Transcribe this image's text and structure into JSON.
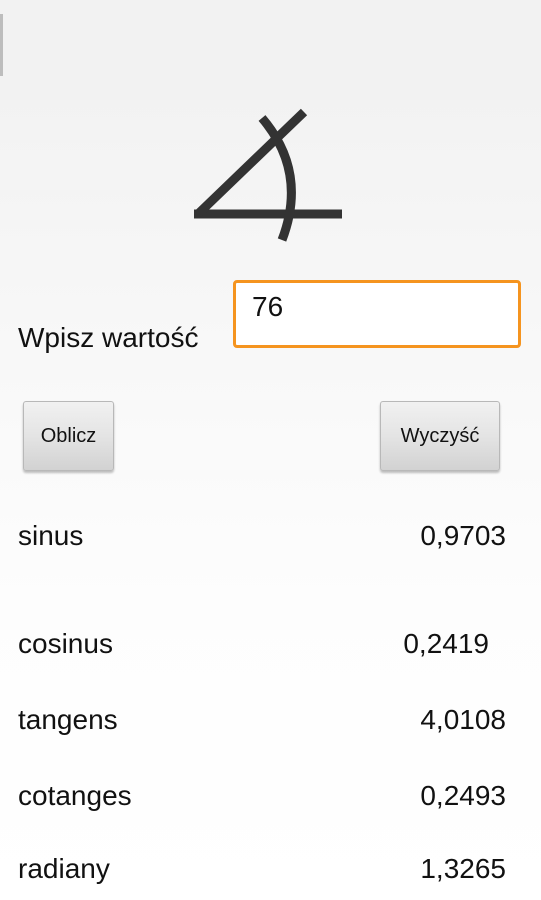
{
  "logo": {
    "icon": "angle-icon"
  },
  "form": {
    "label": "Wpisz wartość",
    "input_value": "76"
  },
  "buttons": {
    "calculate": "Oblicz",
    "clear": "Wyczyść"
  },
  "results": [
    {
      "label": "sinus",
      "value": "0,9703"
    },
    {
      "label": "cosinus",
      "value": "0,2419"
    },
    {
      "label": "tangens",
      "value": "4,0108"
    },
    {
      "label": "cotanges",
      "value": "0,2493"
    },
    {
      "label": "radiany",
      "value": "1,3265"
    }
  ],
  "colors": {
    "input_border": "#f5941f",
    "icon": "#333333"
  }
}
